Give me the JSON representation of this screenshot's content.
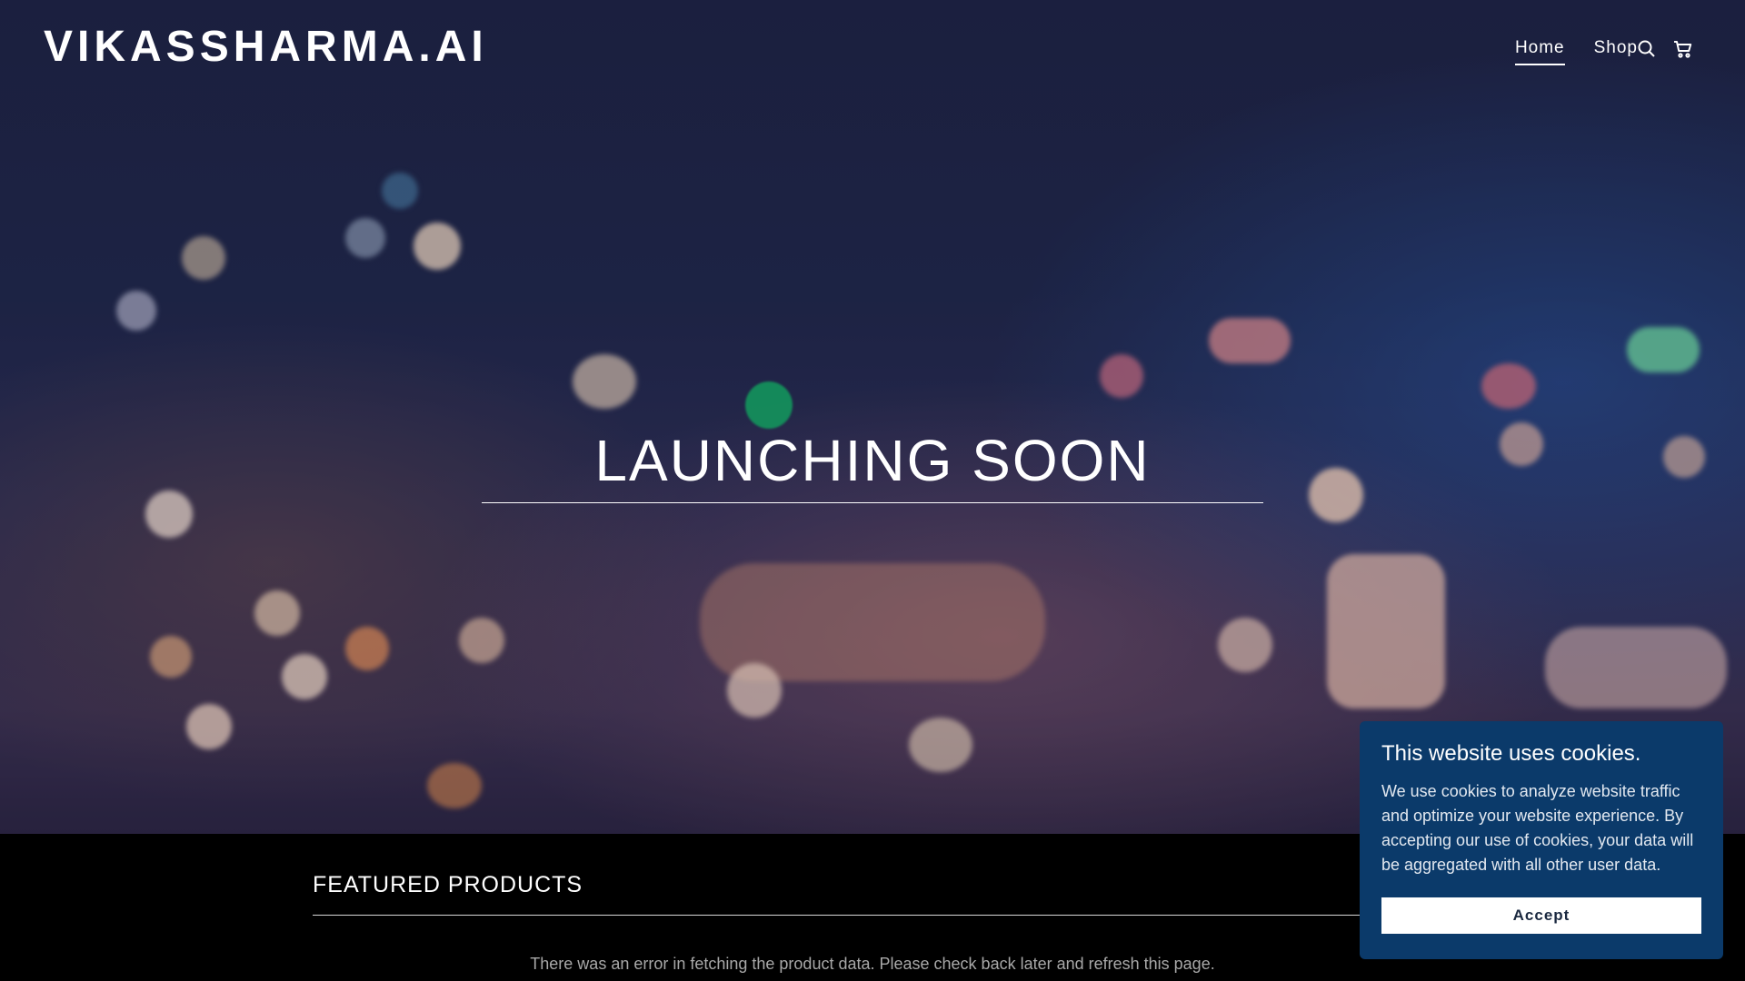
{
  "site": {
    "logo": "VIKASSHARMA.AI"
  },
  "nav": {
    "items": [
      {
        "label": "Home",
        "active": true
      },
      {
        "label": "Shop",
        "active": false
      }
    ],
    "icons": [
      "search-icon",
      "cart-icon"
    ]
  },
  "hero": {
    "title": "LAUNCHING SOON"
  },
  "featured": {
    "heading": "FEATURED PRODUCTS",
    "error": "There was an error in fetching the product data. Please check back later and refresh this page."
  },
  "cookie": {
    "title": "This website uses cookies.",
    "body": "We use cookies to analyze website traffic and optimize your website experience. By accepting our use of cookies, your data will be aggregated with all other user data.",
    "accept_label": "Accept"
  },
  "colors": {
    "cookie_bg": "#0b3a6a",
    "page_bg": "#000000"
  }
}
